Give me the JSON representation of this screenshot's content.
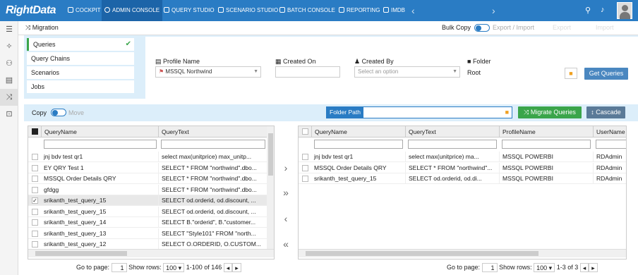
{
  "topnav": {
    "logo": "RightData",
    "items": [
      {
        "label": "COCKPIT",
        "icon": "cockpit-icon"
      },
      {
        "label": "ADMIN CONSOLE",
        "icon": "admin-gear-icon",
        "active": true
      },
      {
        "label": "QUERY STUDIO",
        "icon": "database-icon"
      },
      {
        "label": "SCENARIO STUDIO",
        "icon": "scenario-icon"
      },
      {
        "label": "BATCH CONSOLE",
        "icon": "batch-icon"
      },
      {
        "label": "REPORTING",
        "icon": "report-icon"
      },
      {
        "label": "IMDB",
        "icon": "imdb-icon"
      }
    ],
    "prev_glyph": "‹",
    "next_glyph": "›",
    "accent": "#2a7cc4"
  },
  "subheader": {
    "title": "Migration",
    "bulk_copy": "Bulk Copy",
    "export_import": "Export / Import",
    "export": "Export",
    "import": "Import"
  },
  "tabs": [
    {
      "label": "Queries",
      "active": true
    },
    {
      "label": "Query Chains"
    },
    {
      "label": "Scenarios"
    },
    {
      "label": "Jobs"
    }
  ],
  "form": {
    "profile_label": "Profile Name",
    "profile_value": "MSSQL Northwind",
    "created_on_label": "Created On",
    "created_by_label": "Created By",
    "created_by_placeholder": "Select an option",
    "folder_label": "Folder",
    "folder_value": "Root",
    "get_queries": "Get Queries"
  },
  "midbar": {
    "copy": "Copy",
    "move": "Move",
    "folder_path": "Folder Path",
    "migrate": "Migrate Queries",
    "cascade": "Cascade"
  },
  "left_grid": {
    "headers": [
      "QueryName",
      "QueryText"
    ],
    "rows": [
      {
        "name": "jnj bdv test qr1",
        "text": "select max(unitprice) max_unitp..."
      },
      {
        "name": "EY QRY Test 1",
        "text": "SELECT * FROM \"northwind\".dbo..."
      },
      {
        "name": "MSSQL Order Details QRY",
        "text": "SELECT * FROM \"northwind\".dbo..."
      },
      {
        "name": "gfdgg",
        "text": "SELECT * FROM \"northwind\".dbo..."
      },
      {
        "name": "srikanth_test_query_15",
        "text": "SELECT od.orderid, od.discount, ...",
        "checked": true
      },
      {
        "name": "srikanth_test_query_15",
        "text": "SELECT od.orderid, od.discount, ..."
      },
      {
        "name": "srikanth_test_query_14",
        "text": "SELECT B.\"orderid\", B.\"customer..."
      },
      {
        "name": "srikanth_test_query_13",
        "text": "SELECT \"Style101\" FROM \"north..."
      },
      {
        "name": "srikanth_test_query_12",
        "text": "SELECT O.ORDERID, O.CUSTOM..."
      }
    ],
    "goto_label": "Go to page:",
    "page": "1",
    "show_rows_label": "Show rows:",
    "rows_per_page": "100",
    "range": "1-100 of 146"
  },
  "right_grid": {
    "headers": [
      "QueryName",
      "QueryText",
      "ProfileName",
      "UserName"
    ],
    "rows": [
      {
        "name": "jnj bdv test qr1",
        "text": "select max(unitprice) ma...",
        "profile": "MSSQL POWERBI",
        "user": "RDAdmin"
      },
      {
        "name": "MSSQL Order Details QRY",
        "text": "SELECT * FROM \"northwind\"...",
        "profile": "MSSQL POWERBI",
        "user": "RDAdmin"
      },
      {
        "name": "srikanth_test_query_15",
        "text": "SELECT od.orderid, od.di...",
        "profile": "MSSQL POWERBI",
        "user": "RDAdmin"
      }
    ],
    "goto_label": "Go to page:",
    "page": "1",
    "show_rows_label": "Show rows:",
    "rows_per_page": "100",
    "range": "1-3 of 3"
  },
  "move_glyphs": {
    "right": "›",
    "all_right": "»",
    "left": "‹",
    "all_left": "«"
  }
}
